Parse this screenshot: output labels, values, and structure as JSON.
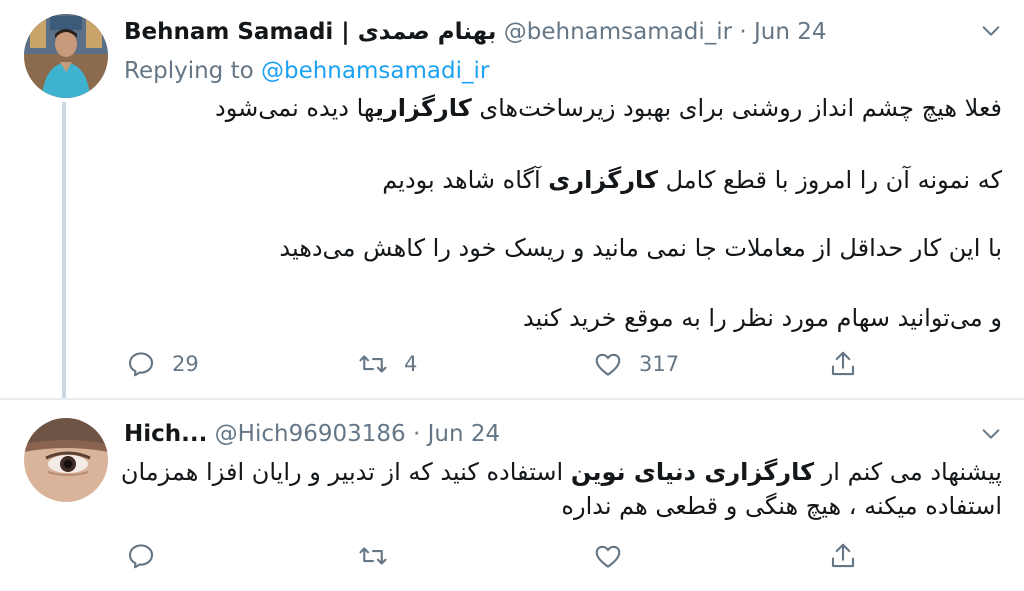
{
  "tweets": [
    {
      "author_name": "Behnam Samadi | بهنام صمدی",
      "handle": "@behnamsamadi_ir",
      "separator": "·",
      "date": "Jun 24",
      "replying_label": "Replying to",
      "replying_handle": "@behnamsamadi_ir",
      "lines": [
        [
          "فعلا هیچ چشم انداز روشنی برای بهبود زیرساخت‌های ",
          "کارگزاری",
          "ها دیده نمی‌شود"
        ],
        [
          "که نمونه آن را امروز با قطع کامل ",
          "کارگزاری",
          " آگاه شاهد بودیم"
        ],
        [
          "با این کار حداقل از معاملات جا نمی مانید و ریسک خود را کاهش می‌دهید"
        ],
        [
          "و می‌توانید سهام مورد نظر را به موقع خرید کنید"
        ]
      ],
      "reply_count": "29",
      "retweet_count": "4",
      "like_count": "317",
      "reply_icon": "reply-icon",
      "retweet_icon": "retweet-icon",
      "like_icon": "like-icon",
      "share_icon": "share-icon"
    },
    {
      "author_name": "Hich...",
      "handle": "@Hich96903186",
      "separator": "·",
      "date": "Jun 24",
      "lines": [
        [
          "پیشنهاد می کنم ار ",
          "کارگزاری دنیای نوین",
          " استفاده کنید که از تدبیر و رایان افزا همزمان"
        ],
        [
          "استفاده میکنه ، هیچ هنگی و قطعی هم نداره"
        ]
      ],
      "reply_count": "",
      "retweet_count": "",
      "like_count": "",
      "reply_icon": "reply-icon",
      "retweet_icon": "retweet-icon",
      "like_icon": "like-icon",
      "share_icon": "share-icon"
    }
  ],
  "colors": {
    "text": "#14171a",
    "muted": "#657786",
    "link": "#1da1f2",
    "divider": "#e6ecf0",
    "thread_line": "#ccd6dd"
  }
}
